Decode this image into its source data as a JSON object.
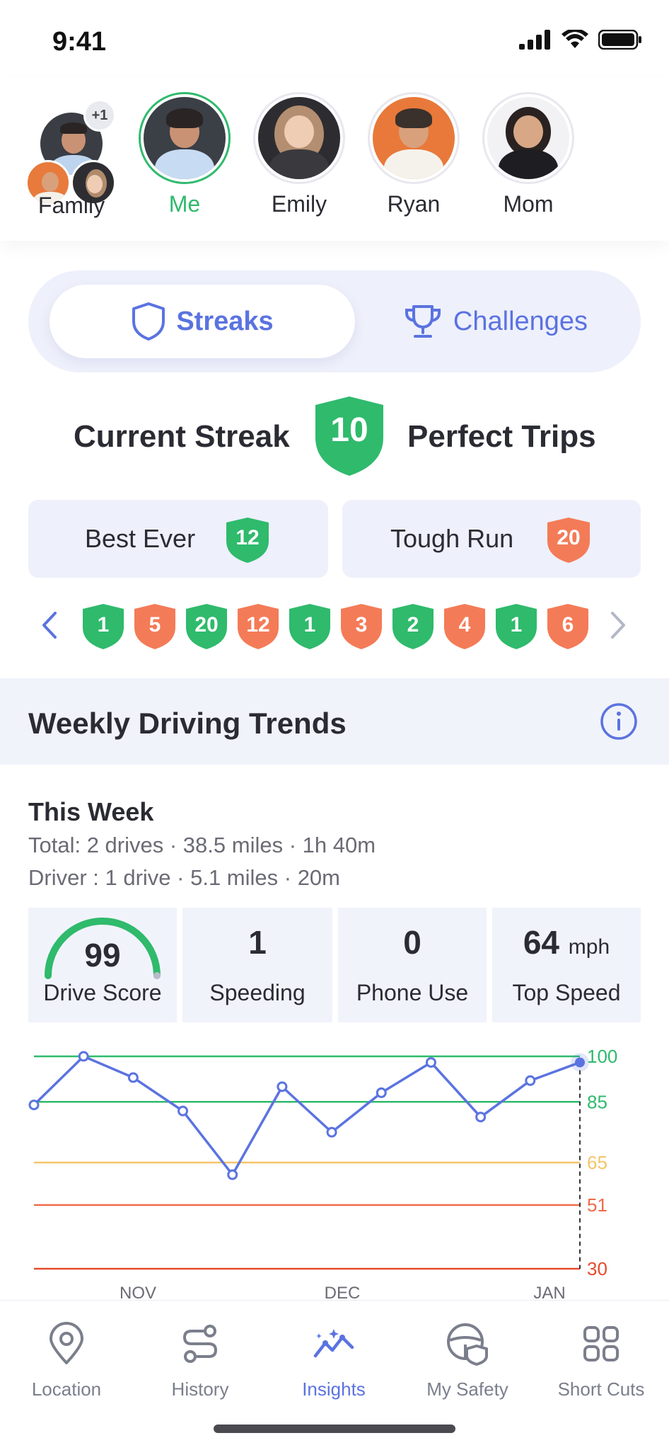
{
  "status_bar": {
    "time": "9:41"
  },
  "people": {
    "family": {
      "name": "Family",
      "extra_count": "+1"
    },
    "members": [
      {
        "name": "Me",
        "active": true
      },
      {
        "name": "Emily",
        "active": false
      },
      {
        "name": "Ryan",
        "active": false
      },
      {
        "name": "Mom",
        "active": false
      }
    ]
  },
  "segment": {
    "streaks_label": "Streaks",
    "challenges_label": "Challenges"
  },
  "streak": {
    "current_label": "Current Streak",
    "current_value": "10",
    "suffix": "Perfect Trips"
  },
  "best_ever": {
    "label": "Best Ever",
    "value": "12"
  },
  "tough_run": {
    "label": "Tough Run",
    "value": "20"
  },
  "history": [
    {
      "value": "1",
      "type": "good"
    },
    {
      "value": "5",
      "type": "bad"
    },
    {
      "value": "20",
      "type": "good"
    },
    {
      "value": "12",
      "type": "bad"
    },
    {
      "value": "1",
      "type": "good"
    },
    {
      "value": "3",
      "type": "bad"
    },
    {
      "value": "2",
      "type": "good"
    },
    {
      "value": "4",
      "type": "bad"
    },
    {
      "value": "1",
      "type": "good"
    },
    {
      "value": "6",
      "type": "bad"
    }
  ],
  "trends": {
    "title": "Weekly Driving Trends",
    "week_title": "This Week",
    "total_line": "Total: 2 drives · 38.5 miles · 1h 40m",
    "driver_line": "Driver : 1 drive · 5.1 miles · 20m"
  },
  "metrics": {
    "drive_score": {
      "value": "99",
      "label": "Drive Score"
    },
    "speeding": {
      "value": "1",
      "label": "Speeding"
    },
    "phone_use": {
      "value": "0",
      "label": "Phone Use"
    },
    "top_speed": {
      "value": "64",
      "unit": "mph",
      "label": "Top Speed"
    }
  },
  "chart_data": {
    "type": "line",
    "y_ticks": [
      100,
      85,
      65,
      51,
      30
    ],
    "ylim": [
      30,
      100
    ],
    "x_tick_labels": [
      "NOV",
      "DEC",
      "JAN"
    ],
    "values": [
      84,
      100,
      93,
      82,
      61,
      90,
      75,
      88,
      98,
      80,
      92,
      98
    ],
    "threshold_colors": [
      "#2fba6c",
      "#2fba6c",
      "#f4c56a",
      "#ef6b4a",
      "#e54b2c"
    ]
  },
  "tabs": [
    {
      "label": "Location",
      "icon": "location-pin-icon",
      "active": false
    },
    {
      "label": "History",
      "icon": "route-icon",
      "active": false
    },
    {
      "label": "Insights",
      "icon": "insights-icon",
      "active": true
    },
    {
      "label": "My Safety",
      "icon": "safety-wheel-icon",
      "active": false
    },
    {
      "label": "Short Cuts",
      "icon": "grid-icon",
      "active": false
    }
  ],
  "colors": {
    "accent": "#5b73e0",
    "good": "#2fba6c",
    "bad": "#f47b57"
  }
}
